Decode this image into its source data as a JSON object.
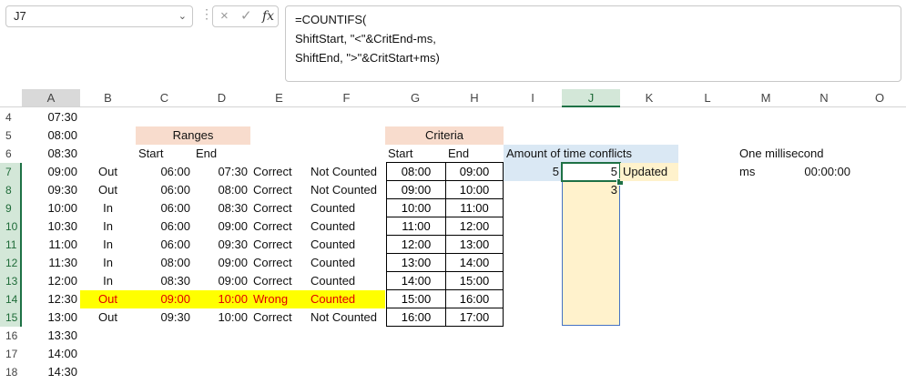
{
  "name_box": "J7",
  "formula_lines": [
    "=COUNTIFS(",
    "ShiftStart, \"<\"&CritEnd-ms,",
    "ShiftEnd, \">\"&CritStart+ms)"
  ],
  "icons": {
    "cancel": "×",
    "enter": "✓",
    "fx": "fx",
    "chevron": "⌄"
  },
  "columns": [
    "A",
    "B",
    "C",
    "D",
    "E",
    "F",
    "G",
    "H",
    "I",
    "J",
    "K",
    "L",
    "M",
    "N",
    "O"
  ],
  "rows": [
    "4",
    "5",
    "6",
    "7",
    "8",
    "9",
    "10",
    "11",
    "12",
    "13",
    "14",
    "15",
    "16",
    "17",
    "18"
  ],
  "times": [
    "07:30",
    "08:00",
    "08:30",
    "09:00",
    "09:30",
    "10:00",
    "10:30",
    "11:00",
    "11:30",
    "12:00",
    "12:30",
    "13:00",
    "13:30",
    "14:00",
    "14:30"
  ],
  "ranges_header": "Ranges",
  "start_label": "Start",
  "end_label": "End",
  "criteria_header": "Criteria",
  "crit_start_label": "Start",
  "crit_end_label": "End",
  "shifts": [
    {
      "status": "Out",
      "start": "06:00",
      "end": "07:30",
      "check": "Correct",
      "counted": "Not Counted"
    },
    {
      "status": "Out",
      "start": "06:00",
      "end": "08:00",
      "check": "Correct",
      "counted": "Not Counted"
    },
    {
      "status": "In",
      "start": "06:00",
      "end": "08:30",
      "check": "Correct",
      "counted": "Counted"
    },
    {
      "status": "In",
      "start": "06:00",
      "end": "09:00",
      "check": "Correct",
      "counted": "Counted"
    },
    {
      "status": "In",
      "start": "06:00",
      "end": "09:30",
      "check": "Correct",
      "counted": "Counted"
    },
    {
      "status": "In",
      "start": "08:00",
      "end": "09:00",
      "check": "Correct",
      "counted": "Counted"
    },
    {
      "status": "In",
      "start": "08:30",
      "end": "09:00",
      "check": "Correct",
      "counted": "Counted"
    },
    {
      "status": "Out",
      "start": "09:00",
      "end": "10:00",
      "check": "Wrong",
      "counted": "Counted"
    },
    {
      "status": "Out",
      "start": "09:30",
      "end": "10:00",
      "check": "Correct",
      "counted": "Not Counted"
    }
  ],
  "criteria": [
    {
      "start": "08:00",
      "end": "09:00"
    },
    {
      "start": "09:00",
      "end": "10:00"
    },
    {
      "start": "10:00",
      "end": "11:00"
    },
    {
      "start": "11:00",
      "end": "12:00"
    },
    {
      "start": "12:00",
      "end": "13:00"
    },
    {
      "start": "13:00",
      "end": "14:00"
    },
    {
      "start": "14:00",
      "end": "15:00"
    },
    {
      "start": "15:00",
      "end": "16:00"
    },
    {
      "start": "16:00",
      "end": "17:00"
    }
  ],
  "conflicts_label": "Amount of time conflicts",
  "i7_value": "5",
  "j7_value": "5",
  "j8_value": "3",
  "updated_label": "Updated",
  "one_ms_label": "One millisecond",
  "ms_label": "ms",
  "ms_value": "00:00:00"
}
